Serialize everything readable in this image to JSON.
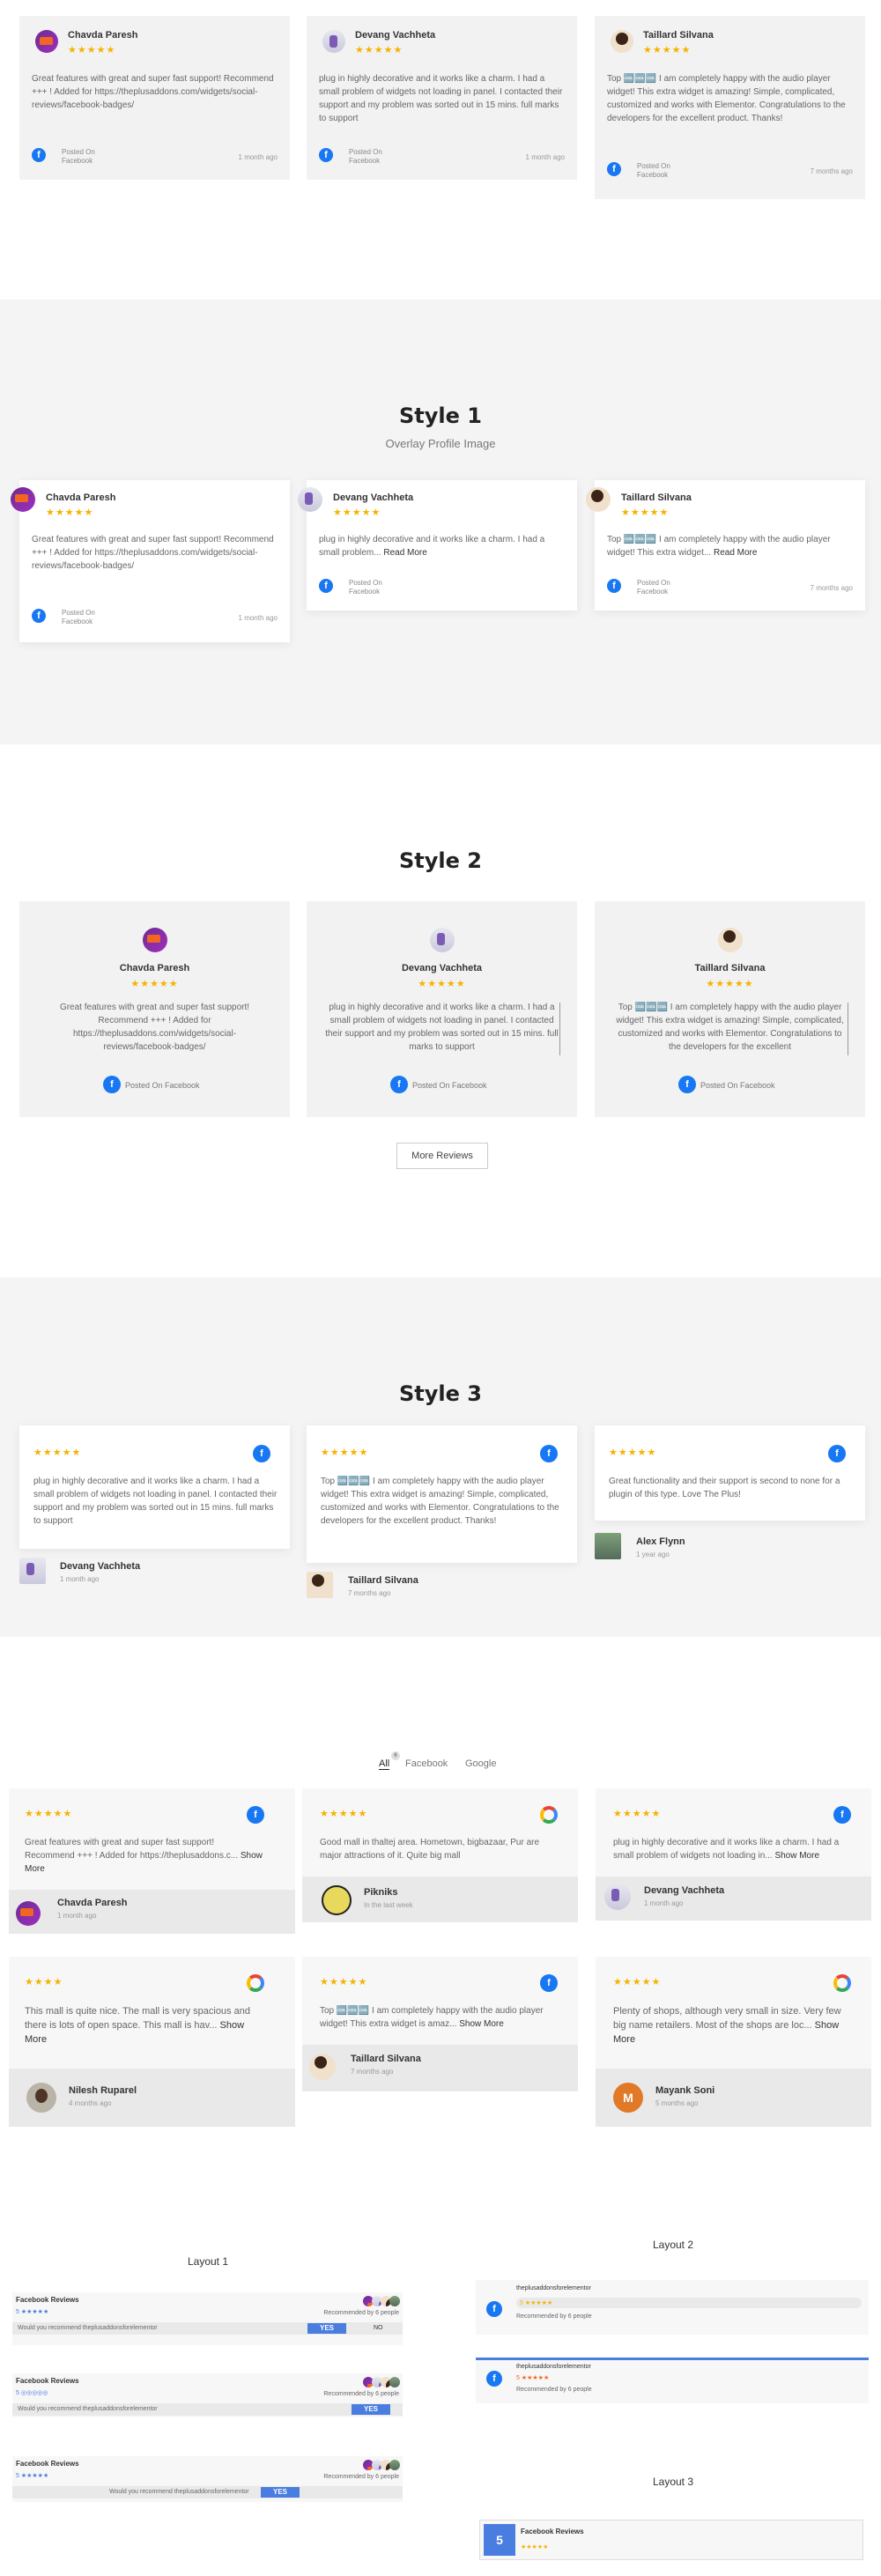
{
  "colors": {
    "accent": "#1877f2",
    "star": "#f5b301",
    "section_bg": "#f4f4f4",
    "btn_blue": "#4a7de0"
  },
  "reviewers": {
    "chavda": {
      "name": "Chavda Paresh"
    },
    "devang": {
      "name": "Devang Vachheta"
    },
    "taillard": {
      "name": "Taillard Silvana"
    },
    "alex": {
      "name": "Alex Flynn"
    },
    "pikniks": {
      "name": "Pikniks"
    },
    "nilesh": {
      "name": "Nilesh Ruparel"
    },
    "mayank": {
      "name": "Mayank Soni",
      "initial": "M"
    }
  },
  "stars5": "★★★★★",
  "stars4": "★★★★",
  "posted_on": "Posted On",
  "facebook": "Facebook",
  "posted_on_facebook": "Posted On Facebook",
  "read_more": "Read More",
  "show_more": "Show More",
  "top": {
    "c1": {
      "text": "Great features with great and super fast support! Recommend +++ ! Added for https://theplusaddons.com/widgets/social-reviews/facebook-badges/",
      "time": "1 month ago"
    },
    "c2": {
      "text": "plug in highly decorative and it works like a charm. I had a small problem of widgets not loading in panel. I contacted their support and my problem was sorted out in 15 mins. full marks to support",
      "time": "1 month ago"
    },
    "c3": {
      "text": "Top 🆒🆒🆒 I am completely happy with the audio player widget! This extra widget is amazing! Simple, complicated, customized and works with Elementor. Congratulations to the developers for the excellent product. Thanks!",
      "time": "7 months ago"
    }
  },
  "style1": {
    "title": "Style 1",
    "subtitle": "Overlay Profile Image",
    "c1": {
      "text": "Great features with great and super fast support! Recommend +++ ! Added for https://theplusaddons.com/widgets/social-reviews/facebook-badges/",
      "time": "1 month ago"
    },
    "c2": {
      "text": "plug in highly decorative and it works like a charm. I had a small problem...",
      "time": ""
    },
    "c3": {
      "text": "Top 🆒🆒🆒 I am completely happy with the audio player widget! This extra widget...",
      "time": "7 months ago"
    }
  },
  "style2": {
    "title": "Style 2",
    "c1": {
      "text": "Great features with great and super fast support! Recommend +++ ! Added for https://theplusaddons.com/widgets/social-reviews/facebook-badges/"
    },
    "c2": {
      "text": "plug in highly decorative and it works like a charm. I had a small problem of widgets not loading in panel. I contacted their support and my problem was sorted out in 15 mins. full marks to support"
    },
    "c3": {
      "text": "Top 🆒🆒🆒 I am completely happy with the audio player widget! This extra widget is amazing! Simple, complicated, customized and works with Elementor. Congratulations to the developers for the excellent"
    },
    "more_button": "More Reviews"
  },
  "style3": {
    "title": "Style 3",
    "c1": {
      "text": "plug in highly decorative and it works like a charm. I had a small problem of widgets not loading in panel. I contacted their support and my problem was sorted out in 15 mins. full marks to support",
      "time": "1 month ago"
    },
    "c2": {
      "text": "Top 🆒🆒🆒 I am completely happy with the audio player widget! This extra widget is amazing! Simple, complicated, customized and works with Elementor. Congratulations to the developers for the excellent product. Thanks!",
      "time": "7 months ago"
    },
    "c3": {
      "text": "Great functionality and their support is second to none for a plugin of this type. Love The Plus!",
      "time": "1 year ago"
    }
  },
  "filter": {
    "tabs": [
      "All",
      "Facebook",
      "Google"
    ],
    "all_count": "6",
    "r1": {
      "text": "Great features with great and super fast support! Recommend +++ ! Added for https://theplusaddons.c...",
      "time": "1 month ago"
    },
    "r2": {
      "text": "Good mall in thaltej area. Hometown, bigbazaar, Pur are major attractions of it. Quite big mall",
      "time": "In the last week"
    },
    "r3": {
      "text": "plug in highly decorative and it works like a charm. I had a small problem of widgets not loading in...",
      "time": "1 month ago"
    },
    "r4": {
      "text": "This mall is quite nice. The mall is very spacious and there is lots of open space. This mall is hav...",
      "time": "4 months ago"
    },
    "r5": {
      "text": "Top 🆒🆒🆒 I am completely happy with the audio player widget! This extra widget is amaz...",
      "time": "7 months ago"
    },
    "r6": {
      "text": "Plenty of shops, although very small in size. Very few big name retailers. Most of the shops are loc...",
      "time": "5 months ago"
    }
  },
  "badges": {
    "layout1": "Layout 1",
    "layout2": "Layout 2",
    "layout3": "Layout 3",
    "fb_reviews": "Facebook Reviews",
    "rating": "5",
    "recommended": "Recommended by 6 people",
    "question": "Would you recommend theplusaddonsforelementor",
    "yes": "YES",
    "no": "NO",
    "page_name": "theplusaddonsforelementor"
  }
}
